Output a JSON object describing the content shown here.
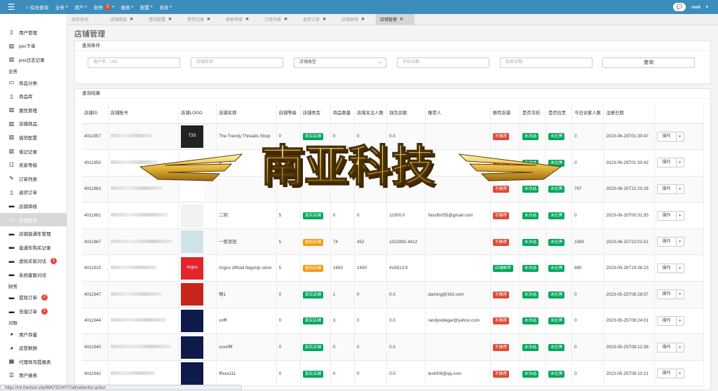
{
  "topbar": {
    "menu": [
      {
        "label": "综合查询",
        "icon": "home-icon"
      },
      {
        "label": "业务",
        "caret": "▾"
      },
      {
        "label": "用户",
        "caret": "▾"
      },
      {
        "label": "财务",
        "badge": "3",
        "caret": "▾"
      },
      {
        "label": "报表",
        "caret": "▾"
      },
      {
        "label": "配置",
        "caret": "▾"
      },
      {
        "label": "系统",
        "caret": "▾"
      }
    ],
    "user": "root",
    "user_caret": "▾"
  },
  "sidebar": {
    "items": [
      {
        "type": "item",
        "label": "用户管理",
        "icon": "▯"
      },
      {
        "type": "item",
        "label": "pos下单",
        "icon": "▥"
      },
      {
        "type": "item",
        "label": "pos日志记录",
        "icon": "▥"
      },
      {
        "type": "group",
        "label": "业务"
      },
      {
        "type": "item",
        "label": "商品分类",
        "icon": "▭"
      },
      {
        "type": "item",
        "label": "商品库",
        "icon": "▯"
      },
      {
        "type": "item",
        "label": "属性管理",
        "icon": "▥"
      },
      {
        "type": "item",
        "label": "店铺商品",
        "icon": "▥"
      },
      {
        "type": "item",
        "label": "借贷配置",
        "icon": "▥"
      },
      {
        "type": "item",
        "label": "借记记录",
        "icon": "▥"
      },
      {
        "type": "item",
        "label": "卖家等级",
        "icon": "☷"
      },
      {
        "type": "item",
        "label": "订单列表",
        "icon": "✎"
      },
      {
        "type": "item",
        "label": "退货订单",
        "icon": "▯"
      },
      {
        "type": "item",
        "label": "店铺审核",
        "icon": "▬"
      },
      {
        "type": "item",
        "label": "店铺管理",
        "icon": "▭",
        "active": true
      },
      {
        "type": "item",
        "label": "店铺直通车管理",
        "icon": "▬"
      },
      {
        "type": "item",
        "label": "直通车购买记录",
        "icon": "▬"
      },
      {
        "type": "item",
        "label": "虚拟买家对话",
        "icon": "▬",
        "badge": "1"
      },
      {
        "type": "item",
        "label": "系统客服对话",
        "icon": "▬"
      },
      {
        "type": "group",
        "label": "财务"
      },
      {
        "type": "item",
        "label": "提现订单",
        "icon": "▬",
        "badge": "2"
      },
      {
        "type": "item",
        "label": "充值订单",
        "icon": "▬",
        "badge": "1"
      },
      {
        "type": "group",
        "label": "对账"
      },
      {
        "type": "item",
        "label": "用户存量",
        "icon": "◕"
      },
      {
        "type": "item",
        "label": "运营数据",
        "icon": "◕"
      },
      {
        "type": "item",
        "label": "代理商充提报表",
        "icon": "▦"
      },
      {
        "type": "item",
        "label": "用户报表",
        "icon": "☰"
      }
    ]
  },
  "tabs": [
    {
      "label": "综合查询",
      "closable": false
    },
    {
      "label": "店铺商品",
      "closable": true
    },
    {
      "label": "借贷配置",
      "closable": true
    },
    {
      "label": "借贷记录",
      "closable": true
    },
    {
      "label": "卖家等级",
      "closable": true
    },
    {
      "label": "订单列表",
      "closable": true
    },
    {
      "label": "退货订单",
      "closable": true
    },
    {
      "label": "店铺审核",
      "closable": true
    },
    {
      "label": "店铺管理",
      "closable": true,
      "active": true
    }
  ],
  "page_title": "店铺管理",
  "query": {
    "title": "查询条件",
    "username_placeholder": "用户名、UID",
    "shopname_placeholder": "店铺名称",
    "shoptype_value": "店铺类型",
    "start_placeholder": "开始日期",
    "end_placeholder": "结束日期",
    "search_label": "查询"
  },
  "results": {
    "title": "查询结果",
    "columns": [
      "店铺ID",
      "店铺账号",
      "店铺LOGO",
      "店铺名称",
      "店铺等级",
      "店铺类型",
      "商品数量",
      "店铺关注人数",
      "钱包余额",
      "推荐人",
      "推荐店铺",
      "是否冻结",
      "是否拉黑",
      "今日访客人数",
      "注册日期",
      ""
    ],
    "op_label": "操作",
    "rows": [
      {
        "id": "4011957",
        "logo": "T3S",
        "logo_bg": "#222222",
        "name": "The Trendy Threads Shop",
        "level": "0",
        "type": "真实店铺",
        "type_color": "green",
        "goods": "0",
        "fans": "0",
        "balance": "0.0",
        "referrer": "",
        "recommend": "不推荐",
        "rec_color": "red",
        "frozen": "未冻结",
        "black": "未拉黑",
        "visitors": "0",
        "date": "2023-06-29T01:30:47"
      },
      {
        "id": "4011950",
        "logo": "",
        "logo_bg": "#ffffff",
        "name": "A",
        "level": "",
        "type": "",
        "type_color": "green",
        "goods": "",
        "fans": "",
        "balance": "",
        "referrer": "",
        "recommend": "不推荐",
        "rec_color": "red",
        "frozen": "未冻结",
        "black": "未拉黑",
        "visitors": "0",
        "date": "2023-06-29T01:30:42"
      },
      {
        "id": "4011983",
        "logo": "",
        "logo_bg": "#ffffff",
        "name": "",
        "level": "",
        "type": "",
        "type_color": "green",
        "goods": "",
        "fans": "",
        "balance": "",
        "referrer": "",
        "recommend": "不推荐",
        "rec_color": "red",
        "frozen": "未冻结",
        "black": "未拉黑",
        "visitors": "797",
        "date": "2023-06-20T22:20:26"
      },
      {
        "id": "4011981",
        "logo": "",
        "logo_bg": "#f2f2f2",
        "name": "二玥",
        "level": "5",
        "type": "真实店铺",
        "type_color": "green",
        "goods": "0",
        "fans": "0",
        "balance": "11000.0",
        "referrer": "Nordfx055@gmail.com",
        "recommend": "不推荐",
        "rec_color": "red",
        "frozen": "未冻结",
        "black": "未拉黑",
        "visitors": "0",
        "date": "2023-06-20T00:31:55"
      },
      {
        "id": "4011967",
        "logo": "",
        "logo_bg": "#cfe3ea",
        "name": "一叙良田",
        "level": "5",
        "type": "虚拟店铺",
        "type_color": "orange",
        "goods": "74",
        "fans": "452",
        "balance": "1022892.4412",
        "referrer": "",
        "recommend": "不推荐",
        "rec_color": "red",
        "frozen": "未冻结",
        "black": "未拉黑",
        "visitors": "1080",
        "date": "2023-06-15T22:01:51"
      },
      {
        "id": "4011915",
        "logo": "Argos",
        "logo_bg": "#e0262b",
        "name": "Argos official flagship store",
        "level": "5",
        "type": "虚拟店铺",
        "type_color": "orange",
        "goods": "1693",
        "fans": "1400",
        "balance": "416513.9",
        "referrer": "",
        "recommend": "店铺推荐",
        "rec_color": "green",
        "frozen": "未冻结",
        "black": "未拉黑",
        "visitors": "880",
        "date": "2023-05-26T19:36:23"
      },
      {
        "id": "4011947",
        "logo": "",
        "logo_bg": "#c8241c",
        "name": "啊1",
        "level": "0",
        "type": "真实店铺",
        "type_color": "green",
        "goods": "1",
        "fans": "0",
        "balance": "0.0",
        "referrer": "daming@163.com",
        "recommend": "不推荐",
        "rec_color": "red",
        "frozen": "未冻结",
        "black": "未拉黑",
        "visitors": "0",
        "date": "2023-05-25T08:28:07"
      },
      {
        "id": "4011944",
        "logo": "",
        "logo_bg": "#0e1a4a",
        "name": "xxfff",
        "level": "0",
        "type": "真实店铺",
        "type_color": "green",
        "goods": "3",
        "fans": "0",
        "balance": "0.0",
        "referrer": "randyvidegar@yahoo.com",
        "recommend": "不推荐",
        "rec_color": "red",
        "frozen": "未冻结",
        "black": "未拉黑",
        "visitors": "0",
        "date": "2023-05-25T08:24:01"
      },
      {
        "id": "4011940",
        "logo": "",
        "logo_bg": "#0e1a4a",
        "name": "xxxxffff",
        "level": "0",
        "type": "真实店铺",
        "type_color": "green",
        "goods": "0",
        "fans": "0",
        "balance": "0.0",
        "referrer": "",
        "recommend": "不推荐",
        "rec_color": "red",
        "frozen": "未冻结",
        "black": "未拉黑",
        "visitors": "0",
        "date": "2023-05-25T08:12:38"
      },
      {
        "id": "4011942",
        "logo": "",
        "logo_bg": "#0e1a4a",
        "name": "fffxxx111",
        "level": "0",
        "type": "真实店铺",
        "type_color": "green",
        "goods": "0",
        "fans": "0",
        "balance": "0.0",
        "referrer": "test006@qq.com",
        "recommend": "不推荐",
        "rec_color": "red",
        "frozen": "未冻结",
        "black": "未拉黑",
        "visitors": "0",
        "date": "2023-05-25T08:10:21"
      }
    ]
  },
  "watermark": {
    "text": "南亚科技"
  },
  "statusbar": {
    "url": "https://ml.theihub.site/89473234?/?/all/seller/list.action"
  }
}
